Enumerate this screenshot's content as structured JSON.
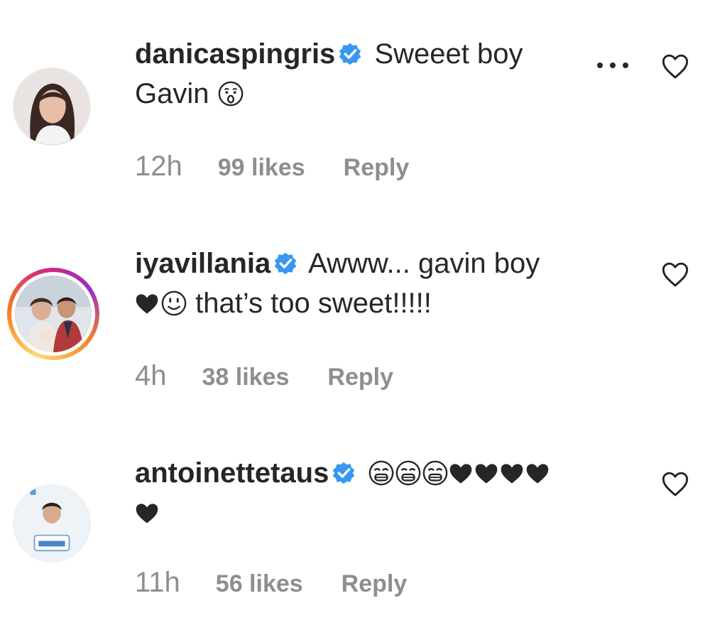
{
  "comments": [
    {
      "username": "danicaspingris",
      "verified": true,
      "text_line1": "Sweeet boy",
      "text_line2": "Gavin",
      "emojis": [
        "astonished-face-icon"
      ],
      "time": "12h",
      "likes": "99 likes",
      "reply": "Reply",
      "has_more_menu": true
    },
    {
      "username": "iyavillania",
      "verified": true,
      "text_line1": "Awww... gavin boy",
      "text_line2": "that’s too sweet!!!!!",
      "emojis": [
        "black-heart-icon",
        "smiling-face-icon"
      ],
      "time": "4h",
      "likes": "38 likes",
      "reply": "Reply",
      "story_ring": true
    },
    {
      "username": "antoinettetaus",
      "verified": true,
      "emojis_line1": [
        "loudly-crying-face-icon",
        "loudly-crying-face-icon",
        "loudly-crying-face-icon",
        "black-heart-icon",
        "black-heart-icon",
        "black-heart-icon",
        "black-heart-icon"
      ],
      "emojis_line2": [
        "black-heart-icon"
      ],
      "time": "11h",
      "likes": "56 likes",
      "reply": "Reply"
    }
  ],
  "colors": {
    "verified_blue": "#3897f0",
    "meta_gray": "#8e8e8e",
    "text": "#262626"
  }
}
